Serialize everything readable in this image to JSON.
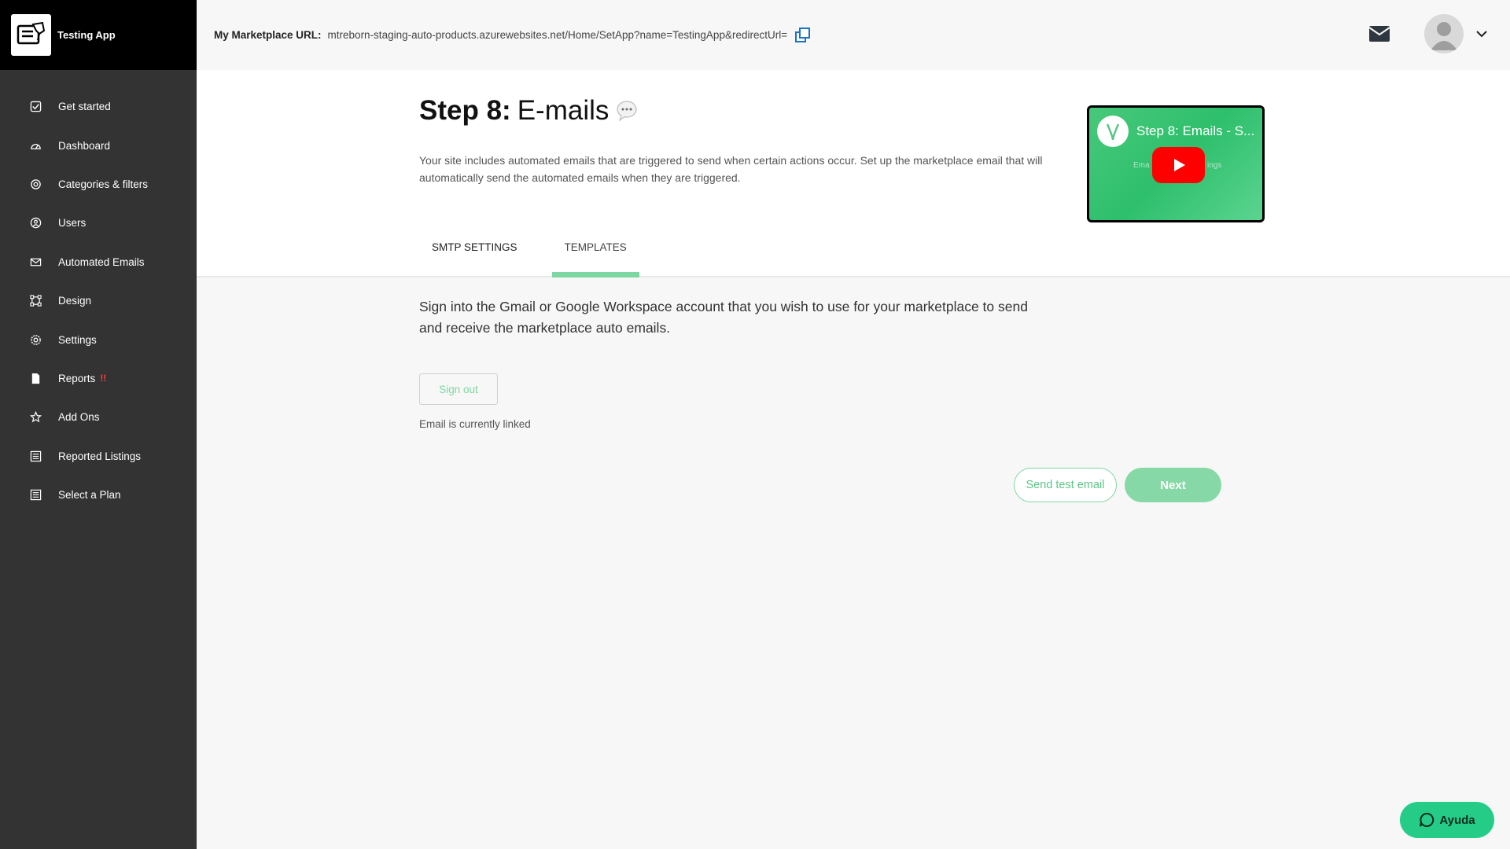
{
  "app": {
    "name": "Testing App"
  },
  "sidebar": {
    "items": [
      {
        "label": "Get started",
        "icon": "checkbox-icon"
      },
      {
        "label": "Dashboard",
        "icon": "gauge-icon"
      },
      {
        "label": "Categories & filters",
        "icon": "target-icon"
      },
      {
        "label": "Users",
        "icon": "user-circle-icon"
      },
      {
        "label": "Automated Emails",
        "icon": "envelope-icon"
      },
      {
        "label": "Design",
        "icon": "design-icon"
      },
      {
        "label": "Settings",
        "icon": "gear-icon"
      },
      {
        "label": "Reports",
        "icon": "file-icon",
        "badge": "!!"
      },
      {
        "label": "Add Ons",
        "icon": "star-icon"
      },
      {
        "label": "Reported Listings",
        "icon": "list-icon"
      },
      {
        "label": "Select a Plan",
        "icon": "list-icon"
      }
    ]
  },
  "topbar": {
    "url_label": "My Marketplace URL:",
    "url_value": "mtreborn-staging-auto-products.azurewebsites.net/Home/SetApp?name=TestingApp&redirectUrl="
  },
  "page": {
    "heading_step": "Step 8:",
    "heading_title": "E-mails",
    "description": "Your site includes automated emails that are triggered to send when certain actions occur. Set up the marketplace email that will automatically send the automated emails when they are triggered.",
    "video_title": "Step 8: Emails - S...",
    "video_sub_left": "Ema",
    "video_sub_right": "ings"
  },
  "tabs": [
    {
      "label": "SMTP SETTINGS",
      "active": false
    },
    {
      "label": "TEMPLATES",
      "active": true
    }
  ],
  "content": {
    "instructions": "Sign into the Gmail or Google Workspace account that you wish to use for your marketplace to send and receive the marketplace auto emails.",
    "signout_label": "Sign out",
    "linked_status": "Email is currently linked",
    "test_email_label": "Send test email",
    "next_label": "Next"
  },
  "help": {
    "label": "Ayuda"
  },
  "colors": {
    "sidebar_bg": "#333333",
    "brand_bg": "#000000",
    "accent_green": "#7ed6a2",
    "help_green": "#25cc88",
    "alert_red": "#ff3b3b",
    "link_blue": "#1a73c8"
  }
}
